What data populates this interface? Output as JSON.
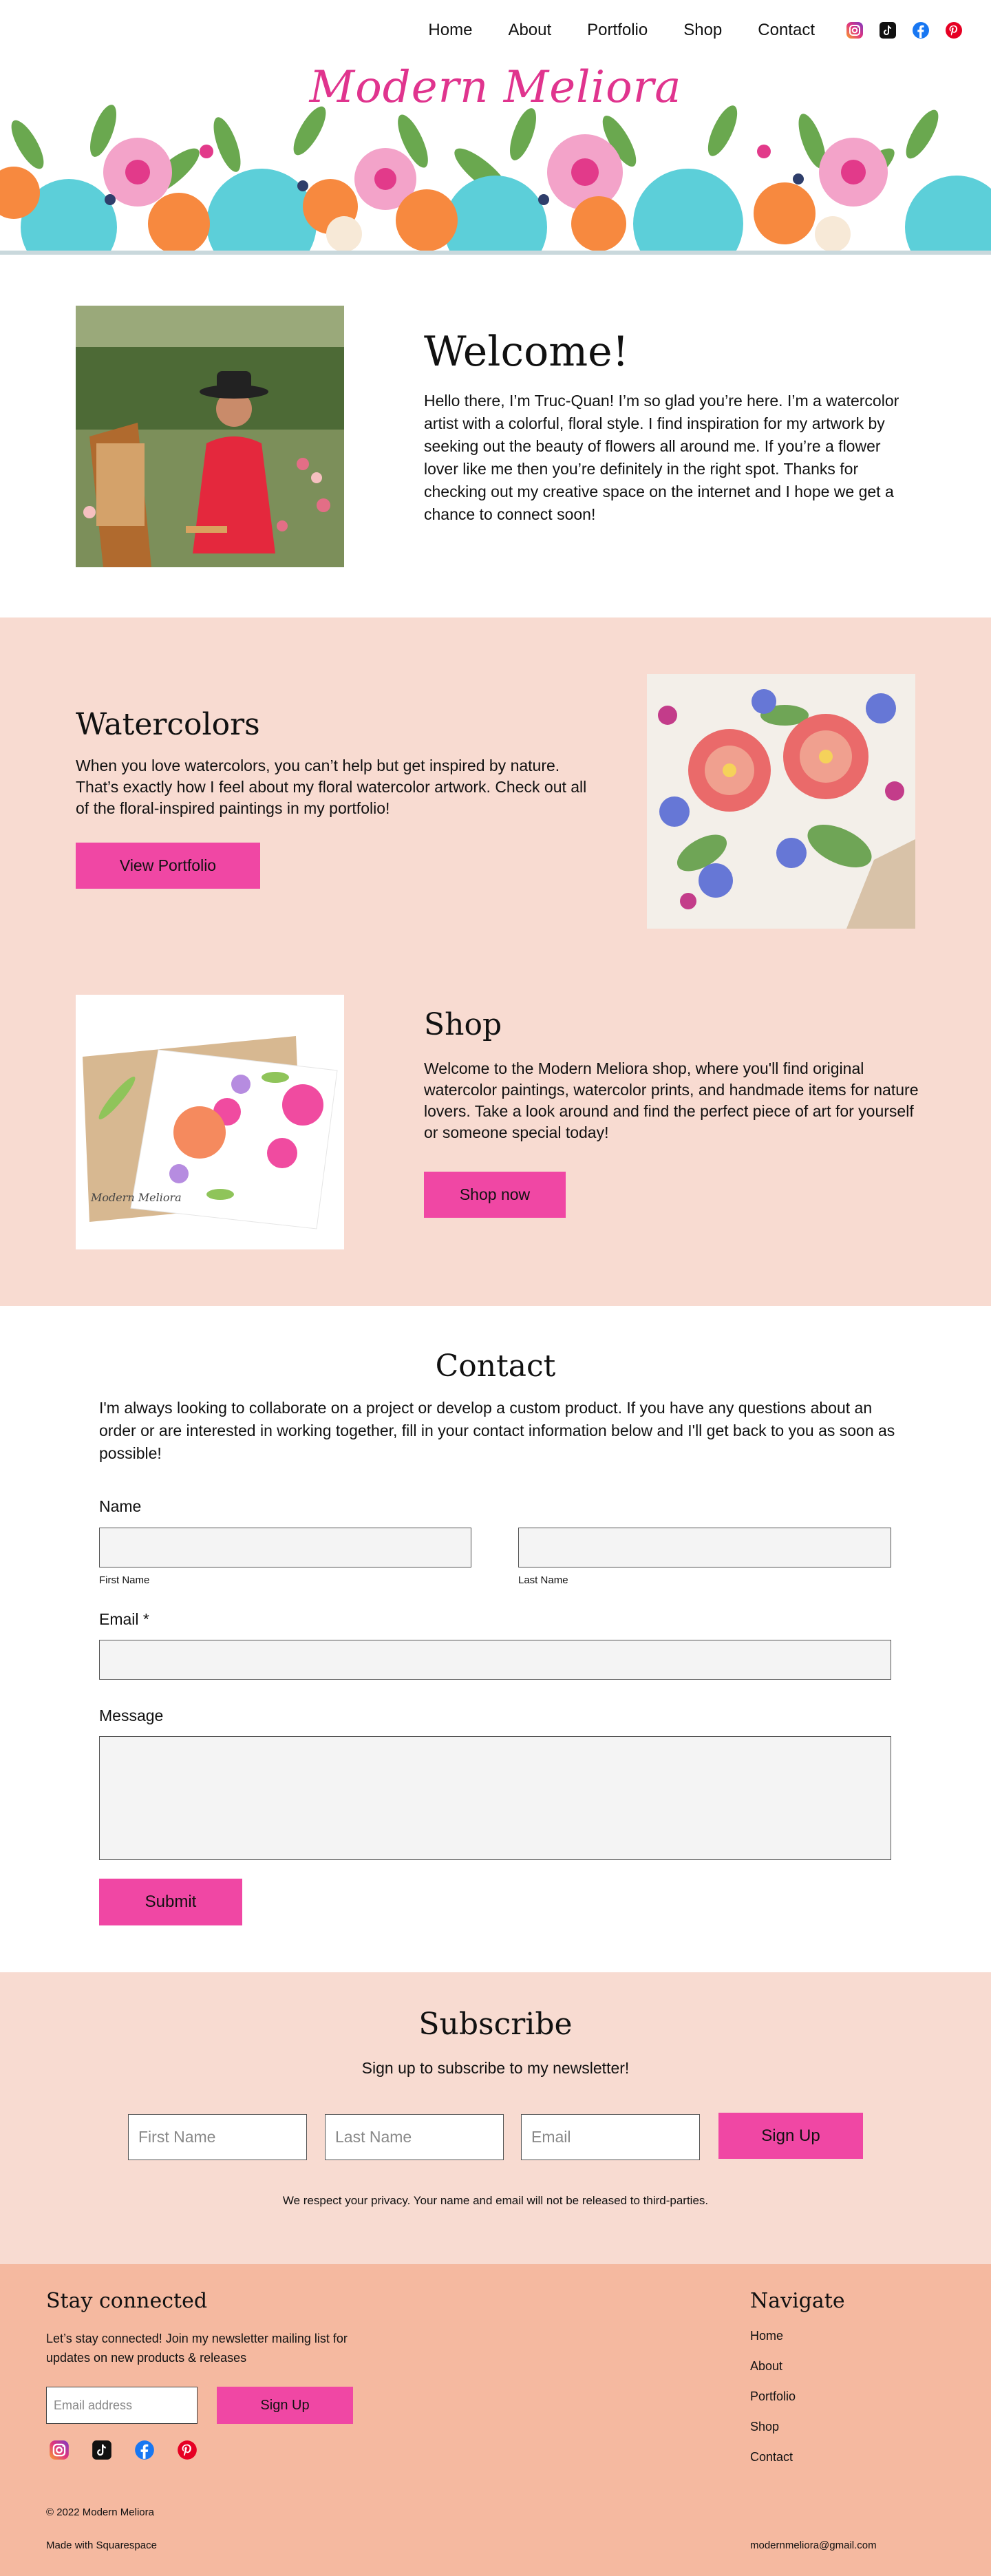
{
  "header": {
    "nav": [
      "Home",
      "About",
      "Portfolio",
      "Shop",
      "Contact"
    ],
    "logo_text": "Modern Meliora",
    "social_icons": [
      "instagram-icon",
      "tiktok-icon",
      "facebook-icon",
      "pinterest-icon"
    ]
  },
  "welcome": {
    "title": "Welcome!",
    "text": "Hello there, I’m Truc-Quan! I’m so glad you’re here. I’m a watercolor artist with a colorful, floral style. I find inspiration for my artwork by seeking out the beauty of flowers all around me. If you’re a flower lover like me then you’re definitely in the right spot. Thanks for checking out my creative space on the internet and I hope we get a chance to connect soon!"
  },
  "watercolors": {
    "title": "Watercolors",
    "text": "When you love watercolors, you can’t help but get inspired by nature. That’s exactly how I feel about my floral watercolor artwork. Check out all of the floral-inspired paintings in my portfolio!",
    "button": "View Portfolio"
  },
  "shop": {
    "title": "Shop",
    "text": "Welcome to the Modern Meliora shop, where you'll find original watercolor paintings, watercolor prints, and handmade items for nature lovers. Take a look around and find the perfect piece of art for yourself or someone special today!",
    "button": "Shop now",
    "card_signature": "Modern Meliora"
  },
  "contact": {
    "title": "Contact",
    "intro": "I'm always looking to collaborate on a project or develop a custom product. If you have any questions about an order or are interested in working together, fill in your contact information below and I'll get back to you as soon as possible!",
    "name_label": "Name",
    "first_name_label": "First Name",
    "last_name_label": "Last Name",
    "email_label": "Email *",
    "message_label": "Message",
    "submit": "Submit"
  },
  "subscribe": {
    "title": "Subscribe",
    "lead": "Sign up to subscribe to my newsletter!",
    "first_name_placeholder": "First Name",
    "last_name_placeholder": "Last Name",
    "email_placeholder": "Email",
    "button": "Sign Up",
    "privacy": "We respect your privacy. Your name and email will not be released to third-parties."
  },
  "footer": {
    "stay_title": "Stay connected",
    "stay_text": "Let’s stay connected! Join my newsletter mailing list for updates on new products & releases",
    "email_placeholder": "Email address",
    "button": "Sign Up",
    "navigate_title": "Navigate",
    "nav": [
      "Home",
      "About",
      "Portfolio",
      "Shop",
      "Contact"
    ],
    "copyright": "© 2022 Modern Meliora",
    "made_with": "Made with Squarespace",
    "email": "modernmeliora@gmail.com"
  },
  "colors": {
    "accent": "#f047a4",
    "band": "#f8dbd1",
    "footer": "#f5b9a0",
    "logo": "#e0348e"
  }
}
